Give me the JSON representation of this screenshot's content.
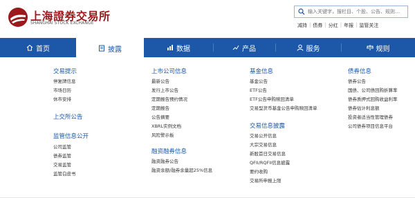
{
  "header": {
    "logo_cn": "上海證券交易所",
    "logo_en": "SHANGHAI STOCK EXCHANGE",
    "search_placeholder": "输入关键字，搜栏目、个股、公告、规则…",
    "quick_links": [
      "减持",
      "债券",
      "分红",
      "年报",
      "监管关注"
    ]
  },
  "nav": {
    "items": [
      {
        "label": "首页",
        "icon": "home-icon"
      },
      {
        "label": "披露",
        "icon": "document-icon",
        "active": true
      },
      {
        "label": "数据",
        "icon": "data-icon"
      },
      {
        "label": "产品",
        "icon": "chart-icon"
      },
      {
        "label": "服务",
        "icon": "user-icon"
      },
      {
        "label": "规则",
        "icon": "rule-icon"
      }
    ]
  },
  "dropdown": {
    "col1": {
      "title1": "交易提示",
      "links1": [
        "停复牌信息",
        "市场日历",
        "休市安排"
      ],
      "title2": "上交所公告",
      "title3": "监管信息公开",
      "links3": [
        "公司监管",
        "债券监管",
        "交易监管",
        "监管白皮书"
      ]
    },
    "col2": {
      "title1": "上市公司信息",
      "links1": [
        "最新公告",
        "发行上市公告",
        "定期报告预约情况",
        "定期报告",
        "公告摘要",
        "XBRL实例文档",
        "风险警示板"
      ],
      "title2": "融资融券信息",
      "links2": [
        "融资融券公告",
        "融资余额/融券余量超25%信息"
      ]
    },
    "col3": {
      "title1": "基金信息",
      "links1": [
        "基金公告",
        "ETF公告",
        "ETF公告申购赎回清单",
        "交易型货币基金公告申购赎回清单"
      ],
      "title2": "交易信息披露",
      "links2": [
        "交易公开信息",
        "大宗交易信息",
        "新股首日交易信息",
        "QFII/RQFII信息披露",
        "要约收购",
        "交易所申报上限"
      ]
    },
    "col4": {
      "title1": "债券信息",
      "links1": [
        "债券公告",
        "国债、公司债回购折算率",
        "债券质押式回购收益利率",
        "债券估计利息额",
        "投资者适当性管理债券",
        "公司债券项目信息平台"
      ]
    }
  },
  "colors": {
    "brand_red": "#9a1a1d",
    "nav_blue": "#1c57a8"
  }
}
